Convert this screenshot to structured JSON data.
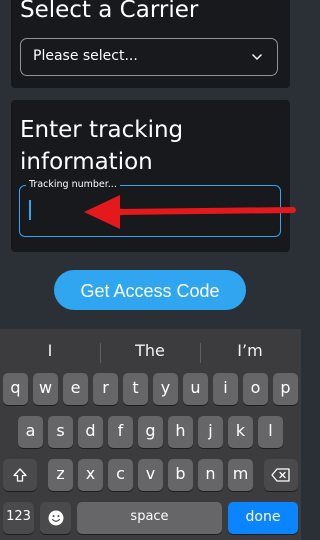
{
  "carrier_section": {
    "title": "Select a Carrier",
    "select_value": "Please select..."
  },
  "tracking_section": {
    "title": "Enter tracking information",
    "input_label": "Tracking number..."
  },
  "action_button": "Get Access Code",
  "keyboard": {
    "suggestions": [
      "I",
      "The",
      "I’m"
    ],
    "row1": [
      "q",
      "w",
      "e",
      "r",
      "t",
      "y",
      "u",
      "i",
      "o",
      "p"
    ],
    "row2": [
      "a",
      "s",
      "d",
      "f",
      "g",
      "h",
      "j",
      "k",
      "l"
    ],
    "row3": [
      "z",
      "x",
      "c",
      "v",
      "b",
      "n",
      "m"
    ],
    "numbers_key": "123",
    "space_key": "space",
    "done_key": "done",
    "shift_icon": "shift-icon",
    "delete_icon": "backspace-icon",
    "emoji_icon": "emoji-icon"
  },
  "colors": {
    "accent": "#2fa6ef",
    "arrow": "#e3191b",
    "background": "#2b3036",
    "card": "#17191d"
  }
}
